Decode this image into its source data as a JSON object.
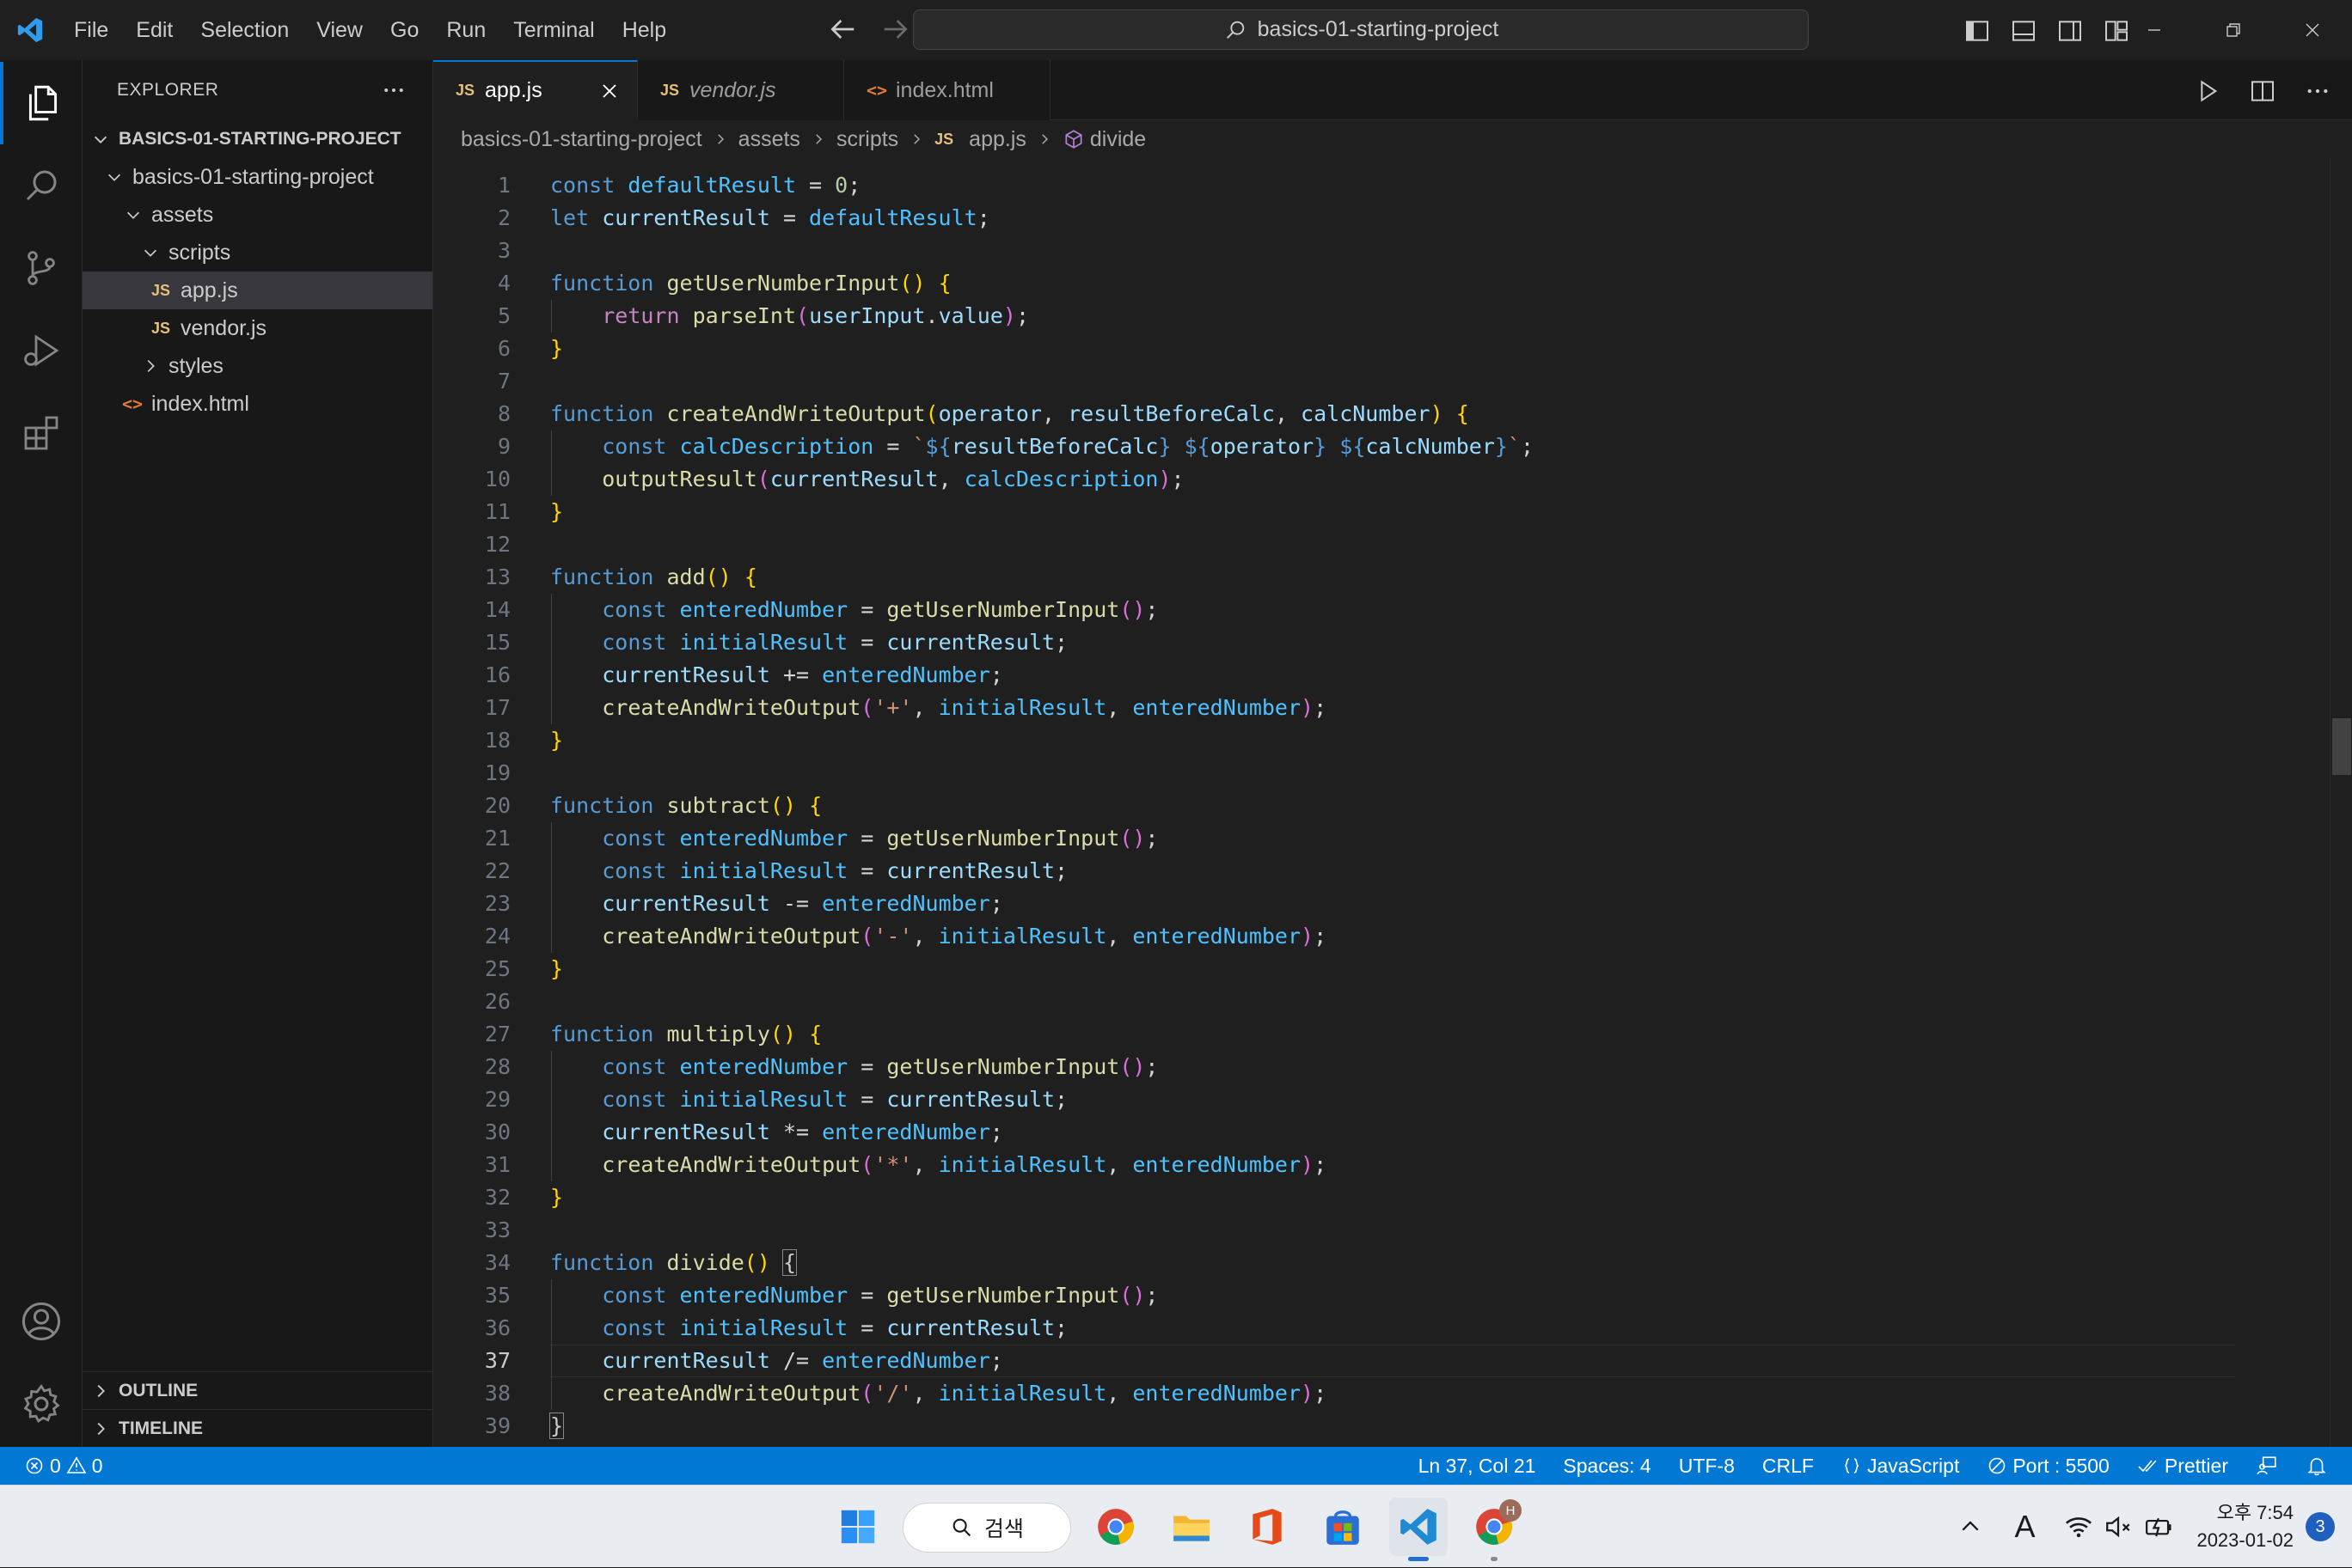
{
  "titlebar": {
    "menus": [
      "File",
      "Edit",
      "Selection",
      "View",
      "Go",
      "Run",
      "Terminal",
      "Help"
    ],
    "search_text": "basics-01-starting-project"
  },
  "sidebar": {
    "title": "EXPLORER",
    "project_root": "BASICS-01-STARTING-PROJECT",
    "tree": [
      {
        "label": "basics-01-starting-project",
        "type": "folder",
        "depth": 0,
        "expanded": true
      },
      {
        "label": "assets",
        "type": "folder",
        "depth": 1,
        "expanded": true
      },
      {
        "label": "scripts",
        "type": "folder",
        "depth": 2,
        "expanded": true
      },
      {
        "label": "app.js",
        "type": "js",
        "depth": 3,
        "selected": true
      },
      {
        "label": "vendor.js",
        "type": "js",
        "depth": 3
      },
      {
        "label": "styles",
        "type": "folder",
        "depth": 2,
        "expanded": false
      },
      {
        "label": "index.html",
        "type": "html",
        "depth": 0
      }
    ],
    "outline_label": "OUTLINE",
    "timeline_label": "TIMELINE"
  },
  "tabs": [
    {
      "label": "app.js",
      "icon": "JS",
      "active": true
    },
    {
      "label": "vendor.js",
      "icon": "JS",
      "italic": true
    },
    {
      "label": "index.html",
      "icon": "<>"
    }
  ],
  "breadcrumb": {
    "parts": [
      "basics-01-starting-project",
      "assets",
      "scripts",
      "app.js",
      "divide"
    ],
    "file_icon": "JS"
  },
  "editor": {
    "current_line": 37,
    "lines": [
      [
        [
          "k",
          "const"
        ],
        [
          "p",
          " "
        ],
        [
          "c",
          "defaultResult"
        ],
        [
          "p",
          " = "
        ],
        [
          "n",
          "0"
        ],
        [
          "p",
          ";"
        ]
      ],
      [
        [
          "k",
          "let"
        ],
        [
          "p",
          " "
        ],
        [
          "v",
          "currentResult"
        ],
        [
          "p",
          " = "
        ],
        [
          "c",
          "defaultResult"
        ],
        [
          "p",
          ";"
        ]
      ],
      [],
      [
        [
          "k",
          "function"
        ],
        [
          "p",
          " "
        ],
        [
          "f",
          "getUserNumberInput"
        ],
        [
          "b1",
          "()"
        ],
        [
          "p",
          " "
        ],
        [
          "b1",
          "{"
        ]
      ],
      [
        [
          "p",
          "    "
        ],
        [
          "kc",
          "return"
        ],
        [
          "p",
          " "
        ],
        [
          "f",
          "parseInt"
        ],
        [
          "b2",
          "("
        ],
        [
          "v",
          "userInput"
        ],
        [
          "p",
          "."
        ],
        [
          "v",
          "value"
        ],
        [
          "b2",
          ")"
        ],
        [
          "p",
          ";"
        ]
      ],
      [
        [
          "b1",
          "}"
        ]
      ],
      [],
      [
        [
          "k",
          "function"
        ],
        [
          "p",
          " "
        ],
        [
          "f",
          "createAndWriteOutput"
        ],
        [
          "b1",
          "("
        ],
        [
          "v",
          "operator"
        ],
        [
          "p",
          ", "
        ],
        [
          "v",
          "resultBeforeCalc"
        ],
        [
          "p",
          ", "
        ],
        [
          "v",
          "calcNumber"
        ],
        [
          "b1",
          ")"
        ],
        [
          "p",
          " "
        ],
        [
          "b1",
          "{"
        ]
      ],
      [
        [
          "p",
          "    "
        ],
        [
          "k",
          "const"
        ],
        [
          "p",
          " "
        ],
        [
          "c",
          "calcDescription"
        ],
        [
          "p",
          " = "
        ],
        [
          "s",
          "`"
        ],
        [
          "k",
          "${"
        ],
        [
          "v",
          "resultBeforeCalc"
        ],
        [
          "k",
          "}"
        ],
        [
          "s",
          " "
        ],
        [
          "k",
          "${"
        ],
        [
          "v",
          "operator"
        ],
        [
          "k",
          "}"
        ],
        [
          "s",
          " "
        ],
        [
          "k",
          "${"
        ],
        [
          "v",
          "calcNumber"
        ],
        [
          "k",
          "}"
        ],
        [
          "s",
          "`"
        ],
        [
          "p",
          ";"
        ]
      ],
      [
        [
          "p",
          "    "
        ],
        [
          "f",
          "outputResult"
        ],
        [
          "b2",
          "("
        ],
        [
          "v",
          "currentResult"
        ],
        [
          "p",
          ", "
        ],
        [
          "c",
          "calcDescription"
        ],
        [
          "b2",
          ")"
        ],
        [
          "p",
          ";"
        ]
      ],
      [
        [
          "b1",
          "}"
        ]
      ],
      [],
      [
        [
          "k",
          "function"
        ],
        [
          "p",
          " "
        ],
        [
          "f",
          "add"
        ],
        [
          "b1",
          "()"
        ],
        [
          "p",
          " "
        ],
        [
          "b1",
          "{"
        ]
      ],
      [
        [
          "p",
          "    "
        ],
        [
          "k",
          "const"
        ],
        [
          "p",
          " "
        ],
        [
          "c",
          "enteredNumber"
        ],
        [
          "p",
          " = "
        ],
        [
          "f",
          "getUserNumberInput"
        ],
        [
          "b2",
          "()"
        ],
        [
          "p",
          ";"
        ]
      ],
      [
        [
          "p",
          "    "
        ],
        [
          "k",
          "const"
        ],
        [
          "p",
          " "
        ],
        [
          "c",
          "initialResult"
        ],
        [
          "p",
          " = "
        ],
        [
          "v",
          "currentResult"
        ],
        [
          "p",
          ";"
        ]
      ],
      [
        [
          "p",
          "    "
        ],
        [
          "v",
          "currentResult"
        ],
        [
          "p",
          " += "
        ],
        [
          "c",
          "enteredNumber"
        ],
        [
          "p",
          ";"
        ]
      ],
      [
        [
          "p",
          "    "
        ],
        [
          "f",
          "createAndWriteOutput"
        ],
        [
          "b2",
          "("
        ],
        [
          "s",
          "'+'"
        ],
        [
          "p",
          ", "
        ],
        [
          "c",
          "initialResult"
        ],
        [
          "p",
          ", "
        ],
        [
          "c",
          "enteredNumber"
        ],
        [
          "b2",
          ")"
        ],
        [
          "p",
          ";"
        ]
      ],
      [
        [
          "b1",
          "}"
        ]
      ],
      [],
      [
        [
          "k",
          "function"
        ],
        [
          "p",
          " "
        ],
        [
          "f",
          "subtract"
        ],
        [
          "b1",
          "()"
        ],
        [
          "p",
          " "
        ],
        [
          "b1",
          "{"
        ]
      ],
      [
        [
          "p",
          "    "
        ],
        [
          "k",
          "const"
        ],
        [
          "p",
          " "
        ],
        [
          "c",
          "enteredNumber"
        ],
        [
          "p",
          " = "
        ],
        [
          "f",
          "getUserNumberInput"
        ],
        [
          "b2",
          "()"
        ],
        [
          "p",
          ";"
        ]
      ],
      [
        [
          "p",
          "    "
        ],
        [
          "k",
          "const"
        ],
        [
          "p",
          " "
        ],
        [
          "c",
          "initialResult"
        ],
        [
          "p",
          " = "
        ],
        [
          "v",
          "currentResult"
        ],
        [
          "p",
          ";"
        ]
      ],
      [
        [
          "p",
          "    "
        ],
        [
          "v",
          "currentResult"
        ],
        [
          "p",
          " -= "
        ],
        [
          "c",
          "enteredNumber"
        ],
        [
          "p",
          ";"
        ]
      ],
      [
        [
          "p",
          "    "
        ],
        [
          "f",
          "createAndWriteOutput"
        ],
        [
          "b2",
          "("
        ],
        [
          "s",
          "'-'"
        ],
        [
          "p",
          ", "
        ],
        [
          "c",
          "initialResult"
        ],
        [
          "p",
          ", "
        ],
        [
          "c",
          "enteredNumber"
        ],
        [
          "b2",
          ")"
        ],
        [
          "p",
          ";"
        ]
      ],
      [
        [
          "b1",
          "}"
        ]
      ],
      [],
      [
        [
          "k",
          "function"
        ],
        [
          "p",
          " "
        ],
        [
          "f",
          "multiply"
        ],
        [
          "b1",
          "()"
        ],
        [
          "p",
          " "
        ],
        [
          "b1",
          "{"
        ]
      ],
      [
        [
          "p",
          "    "
        ],
        [
          "k",
          "const"
        ],
        [
          "p",
          " "
        ],
        [
          "c",
          "enteredNumber"
        ],
        [
          "p",
          " = "
        ],
        [
          "f",
          "getUserNumberInput"
        ],
        [
          "b2",
          "()"
        ],
        [
          "p",
          ";"
        ]
      ],
      [
        [
          "p",
          "    "
        ],
        [
          "k",
          "const"
        ],
        [
          "p",
          " "
        ],
        [
          "c",
          "initialResult"
        ],
        [
          "p",
          " = "
        ],
        [
          "v",
          "currentResult"
        ],
        [
          "p",
          ";"
        ]
      ],
      [
        [
          "p",
          "    "
        ],
        [
          "v",
          "currentResult"
        ],
        [
          "p",
          " *= "
        ],
        [
          "c",
          "enteredNumber"
        ],
        [
          "p",
          ";"
        ]
      ],
      [
        [
          "p",
          "    "
        ],
        [
          "f",
          "createAndWriteOutput"
        ],
        [
          "b2",
          "("
        ],
        [
          "s",
          "'*'"
        ],
        [
          "p",
          ", "
        ],
        [
          "c",
          "initialResult"
        ],
        [
          "p",
          ", "
        ],
        [
          "c",
          "enteredNumber"
        ],
        [
          "b2",
          ")"
        ],
        [
          "p",
          ";"
        ]
      ],
      [
        [
          "b1",
          "}"
        ]
      ],
      [],
      [
        [
          "k",
          "function"
        ],
        [
          "p",
          " "
        ],
        [
          "f",
          "divide"
        ],
        [
          "b1",
          "()"
        ],
        [
          "p",
          " "
        ],
        [
          "bm",
          "{"
        ]
      ],
      [
        [
          "p",
          "    "
        ],
        [
          "k",
          "const"
        ],
        [
          "p",
          " "
        ],
        [
          "c",
          "enteredNumber"
        ],
        [
          "p",
          " = "
        ],
        [
          "f",
          "getUserNumberInput"
        ],
        [
          "b2",
          "()"
        ],
        [
          "p",
          ";"
        ]
      ],
      [
        [
          "p",
          "    "
        ],
        [
          "k",
          "const"
        ],
        [
          "p",
          " "
        ],
        [
          "c",
          "initialResult"
        ],
        [
          "p",
          " = "
        ],
        [
          "v",
          "currentResult"
        ],
        [
          "p",
          ";"
        ]
      ],
      [
        [
          "p",
          "    "
        ],
        [
          "v",
          "currentResult"
        ],
        [
          "p",
          " /= "
        ],
        [
          "c",
          "enteredNumber"
        ],
        [
          "p",
          ";"
        ]
      ],
      [
        [
          "p",
          "    "
        ],
        [
          "f",
          "createAndWriteOutput"
        ],
        [
          "b2",
          "("
        ],
        [
          "s",
          "'/'"
        ],
        [
          "p",
          ", "
        ],
        [
          "c",
          "initialResult"
        ],
        [
          "p",
          ", "
        ],
        [
          "c",
          "enteredNumber"
        ],
        [
          "b2",
          ")"
        ],
        [
          "p",
          ";"
        ]
      ],
      [
        [
          "bm",
          "}"
        ]
      ],
      []
    ]
  },
  "statusbar": {
    "errors": "0",
    "warnings": "0",
    "position": "Ln 37, Col 21",
    "spaces": "Spaces: 4",
    "encoding": "UTF-8",
    "eol": "CRLF",
    "language": "JavaScript",
    "port": "Port : 5500",
    "prettier": "Prettier"
  },
  "taskbar": {
    "search_label": "검색",
    "time": "오후 7:54",
    "date": "2023-01-02",
    "notification_count": "3",
    "chrome_profile_badge": "H",
    "ime_label": "A"
  },
  "colors": {
    "accent": "#0078d4",
    "editor_bg": "#1f1f1f",
    "sidebar_bg": "#181818"
  }
}
